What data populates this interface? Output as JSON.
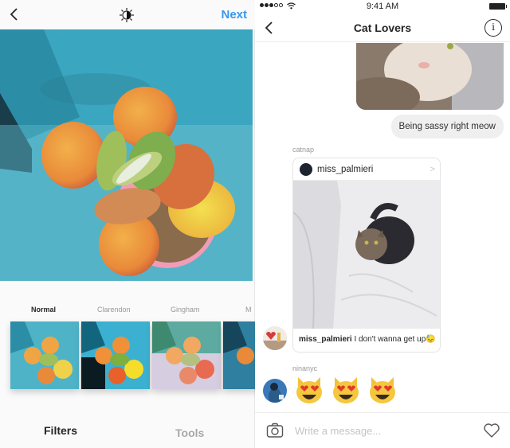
{
  "left_screen": {
    "header": {
      "back_icon": "chevron-left-icon",
      "lux_icon": "lux-sun-icon",
      "next_label": "Next",
      "accent_color": "#3897f0"
    },
    "photo": {
      "description": "succulent plant in pink pot on blue concrete"
    },
    "filters": [
      {
        "label": "Normal",
        "active": true
      },
      {
        "label": "Clarendon",
        "active": false
      },
      {
        "label": "Gingham",
        "active": false
      },
      {
        "label": "M",
        "active": false
      }
    ],
    "tabs": [
      {
        "label": "Filters",
        "active": true
      },
      {
        "label": "Tools",
        "active": false
      }
    ]
  },
  "right_screen": {
    "status_bar": {
      "signal": "●●●○○",
      "time": "9:41 AM"
    },
    "header": {
      "title": "Cat Lovers",
      "info_glyph": "i"
    },
    "messages": {
      "sent_text": "Being sassy right meow",
      "shared_post": {
        "sender": "catnap",
        "username": "miss_palmieri",
        "caption_user": "miss_palmieri",
        "caption_text": " I don't wanna get up😓"
      },
      "emoji_message": {
        "sender": "ninanyc",
        "emojis": [
          "😻",
          "😻",
          "😻"
        ]
      }
    },
    "composer": {
      "placeholder": "Write a message..."
    }
  }
}
